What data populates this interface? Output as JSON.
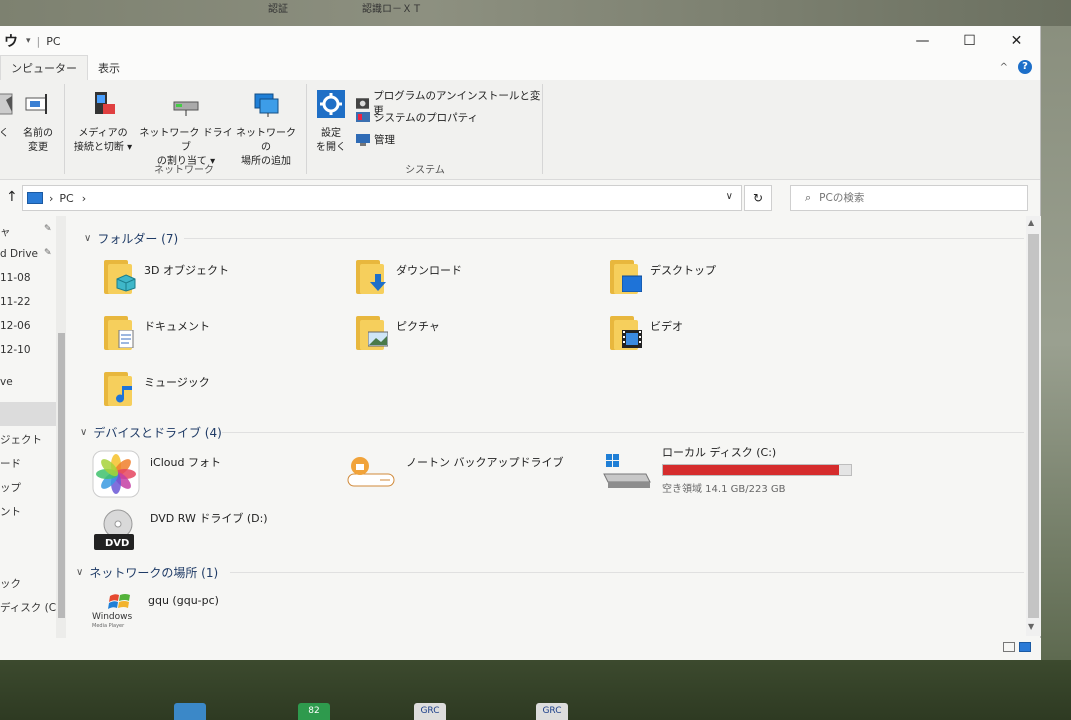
{
  "desktop": {
    "top_labels": [
      "認証",
      "認識ロ－ＸＴ"
    ]
  },
  "window": {
    "title": "PC",
    "quick_access_glyph": "ウ",
    "controls": {
      "minimize": "—",
      "maximize": "☐",
      "close": "✕"
    }
  },
  "tabs": [
    {
      "label": "ンピューター",
      "active": true
    },
    {
      "label": "表示",
      "active": false
    }
  ],
  "ribbon": {
    "location_group": {
      "left_partial_label": "く",
      "rename": {
        "line1": "名前の",
        "line2": "変更"
      }
    },
    "network_group": {
      "label": "ネットワーク",
      "media": {
        "line1": "メディアの",
        "line2": "接続と切断 ▾"
      },
      "map_drive": {
        "line1": "ネットワーク ドライブ",
        "line2": "の割り当て ▾"
      },
      "add_location": {
        "line1": "ネットワークの",
        "line2": "場所の追加"
      }
    },
    "system_group": {
      "label": "システム",
      "settings": {
        "line1": "設定",
        "line2": "を開く"
      },
      "uninstall": "プログラムのアンインストールと変更",
      "properties": "システムのプロパティ",
      "manage": "管理"
    }
  },
  "address": {
    "up_arrow": "↑",
    "crumb_sep": "›",
    "crumb": "PC",
    "crumb_trailing": "›",
    "search_placeholder": "PCの検索"
  },
  "nav": {
    "items": [
      "ャ",
      "d Drive",
      "11-08",
      "11-22",
      "12-06",
      "12-10",
      "ve",
      "ジェクト",
      "ード",
      "ップ",
      "ント",
      "ック",
      "ディスク (C"
    ]
  },
  "groups": {
    "folders": {
      "label": "フォルダー (7)"
    },
    "devices": {
      "label": "デバイスとドライブ (4)"
    },
    "network": {
      "label": "ネットワークの場所 (1)"
    }
  },
  "folders": [
    {
      "name": "3D オブジェクト",
      "badge": "cube"
    },
    {
      "name": "ダウンロード",
      "badge": "download"
    },
    {
      "name": "デスクトップ",
      "badge": "desktop"
    },
    {
      "name": "ドキュメント",
      "badge": "document"
    },
    {
      "name": "ピクチャ",
      "badge": "picture"
    },
    {
      "name": "ビデオ",
      "badge": "video"
    },
    {
      "name": "ミュージック",
      "badge": "music"
    }
  ],
  "devices": [
    {
      "name": "iCloud フォト"
    },
    {
      "name": "ノートン バックアップドライブ"
    },
    {
      "name": "ローカル ディスク (C:)",
      "free_text": "空き領域 14.1 GB/223 GB",
      "used_fraction": 0.937
    },
    {
      "name": "DVD RW ドライブ (D:)",
      "badge_text": "DVD"
    }
  ],
  "network_items": [
    {
      "name": "gqu (gqu-pc)",
      "icon_text": "Windows",
      "icon_subtext": "Media Player"
    }
  ],
  "taskbar": {
    "icons": [
      "",
      "82",
      "GRC",
      "GRC"
    ]
  },
  "colors": {
    "accent": "#1d6fc9",
    "disk_fill": "#d52c2c",
    "folder": "#f6cf5c",
    "group_heading": "#1f3b66"
  }
}
